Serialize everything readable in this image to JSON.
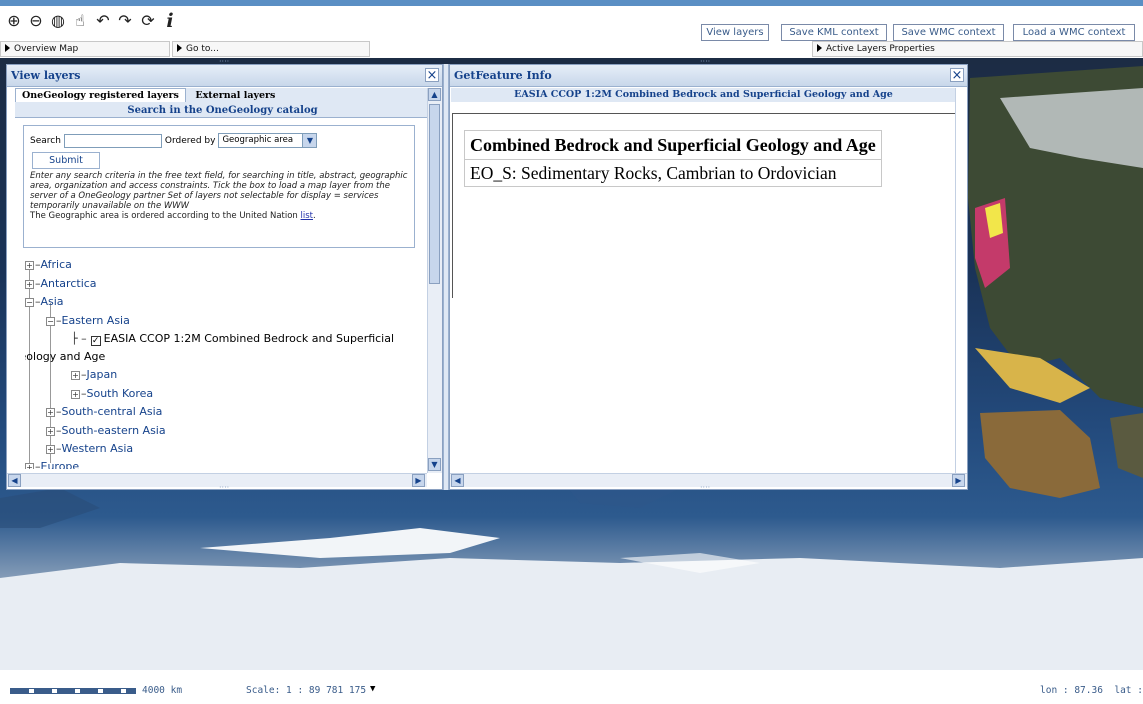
{
  "toolbar": {
    "tools": [
      {
        "name": "zoom-in-icon",
        "glyph": "⊕"
      },
      {
        "name": "zoom-out-icon",
        "glyph": "⊖"
      },
      {
        "name": "globe-icon",
        "glyph": "◍"
      },
      {
        "name": "pan-hand-icon",
        "glyph": "☝"
      },
      {
        "name": "undo-icon",
        "glyph": "↶"
      },
      {
        "name": "redo-icon",
        "glyph": "↷"
      },
      {
        "name": "refresh-icon",
        "glyph": "⟳"
      },
      {
        "name": "info-icon",
        "glyph": "i"
      }
    ],
    "buttons": {
      "view_layers": "View layers",
      "save_kml": "Save KML context",
      "save_wmc": "Save WMC context",
      "load_wmc": "Load a WMC context"
    }
  },
  "subbar": {
    "overview_map": "Overview Map",
    "go_to": "Go to...",
    "active_layers": "Active Layers Properties"
  },
  "view_layers": {
    "title": "View layers",
    "tabs": [
      "OneGeology registered layers",
      "External layers"
    ],
    "search_title": "Search in the OneGeology catalog",
    "search_label": "Search",
    "search_value": "",
    "ordered_by_label": "Ordered by",
    "ordered_by_value": "Geographic area",
    "submit_label": "Submit",
    "help_italic": "Enter any search criteria in the free text field, for searching in title, abstract, geographic area, organization and access constraints. Tick the box to load a map layer from the server of a OneGeology partner Set of layers not selectable for display = services temporarily unavailable on the WWW",
    "help_plain": "The Geographic area is ordered according to the United Nation ",
    "help_link": "list",
    "help_end": ".",
    "tree": {
      "africa": "Africa",
      "antarctica": "Antarctica",
      "asia": "Asia",
      "eastern_asia": "Eastern Asia",
      "layer_line1": "EASIA CCOP 1:2M Combined Bedrock and Superficial",
      "layer_line2": "Geology and Age",
      "japan": "Japan",
      "south_korea": "South Korea",
      "south_central_asia": "South-central Asia",
      "south_eastern_asia": "South-eastern Asia",
      "western_asia": "Western Asia",
      "europe": "Europe"
    }
  },
  "getfeature": {
    "title": "GetFeature Info",
    "layer_header": "EASIA CCOP 1:2M Combined Bedrock and Superficial Geology and Age",
    "table_header": "Combined Bedrock and Superficial Geology and Age",
    "table_value": "EO_S: Sedimentary Rocks, Cambrian to Ordovician"
  },
  "bottom": {
    "scale_distance": "4000 km",
    "scale_ratio": "Scale: 1 : 89 781 175",
    "coords": "lon : 87.36  lat : -"
  },
  "colors": {
    "panel_title": "#15428b",
    "accent": "#5a8fc4"
  }
}
